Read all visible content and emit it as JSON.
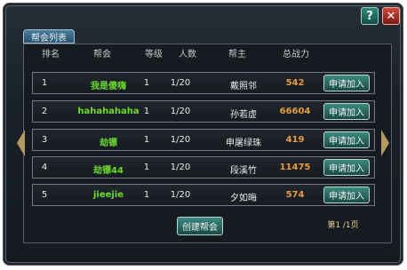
{
  "window": {
    "tab_label": "帮会列表",
    "help_glyph": "?",
    "close_glyph": "✕"
  },
  "table": {
    "headers": {
      "rank": "排名",
      "name": "帮会",
      "level": "等级",
      "members": "人数",
      "leader": "帮主",
      "power": "总战力"
    },
    "rows": [
      {
        "rank": "1",
        "name": "我是傻嗨",
        "level": "1",
        "members": "1/20",
        "leader": "戴照邻",
        "power": "542",
        "action": "申请加入"
      },
      {
        "rank": "2",
        "name": "hahahahaha",
        "level": "1",
        "members": "1/20",
        "leader": "孙若虚",
        "power": "66604",
        "action": "申请加入"
      },
      {
        "rank": "3",
        "name": "劫镖",
        "level": "1",
        "members": "1/20",
        "leader": "申屠绿珠",
        "power": "419",
        "action": "申请加入"
      },
      {
        "rank": "4",
        "name": "劫镖44",
        "level": "1",
        "members": "1/20",
        "leader": "段溪竹",
        "power": "11475",
        "action": "申请加入"
      },
      {
        "rank": "5",
        "name": "jieejie",
        "level": "1",
        "members": "1/20",
        "leader": "夕如晦",
        "power": "574",
        "action": "申请加入"
      }
    ]
  },
  "footer": {
    "create_label": "创建帮会",
    "page_info": "第1 /1页"
  },
  "icons": {
    "help": "help-icon",
    "close": "close-icon",
    "prev": "arrow-left-icon",
    "next": "arrow-right-icon"
  },
  "colors": {
    "guild_name": "#6ddb2b",
    "power": "#e89a3a",
    "button": "#2d7a70"
  }
}
